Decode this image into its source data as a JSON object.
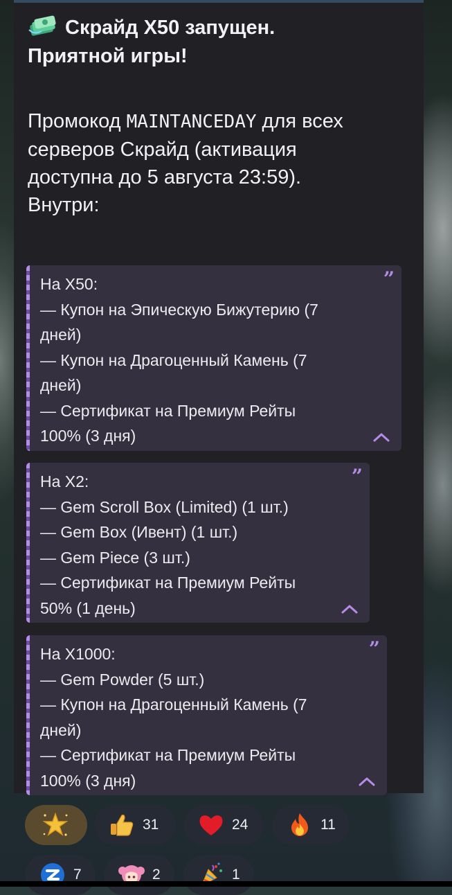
{
  "message": {
    "title_line1": "Скрайд X50 запущен.",
    "title_line2": "Приятной игры!",
    "body_pre": "Промокод ",
    "promo_code": "MAINTANCEDAY",
    "body_post_1": " для всех",
    "body_line2": "серверов Скрайд (активация",
    "body_line3": "доступна до 5 августа 23:59).",
    "body_line4": "Внутри:"
  },
  "quotes": [
    {
      "lines": [
        "На X50:",
        "— Купон на Эпическую Бижутерию (7",
        "дней)",
        "— Купон на Драгоценный Камень (7",
        "дней)",
        "— Сертификат на Премиум Рейты",
        "100% (3 дня)"
      ]
    },
    {
      "lines": [
        "На X2:",
        "— Gem Scroll Box (Limited) (1 шт.)",
        "— Gem Box (Ивент) (1 шт.)",
        "— Gem Piece (3 шт.)",
        "— Сертификат на Премиум Рейты",
        "50% (1 день)"
      ]
    },
    {
      "lines": [
        "На X1000:",
        "— Gem Powder (5 шт.)",
        "— Купон на Драгоценный Камень (7",
        "дней)",
        "— Сертификат на Премиум Рейты",
        "100% (3 дня)"
      ]
    }
  ],
  "reactions": [
    {
      "icon": "sparkle-star-icon",
      "count": ""
    },
    {
      "icon": "thumbs-up-icon",
      "count": "31"
    },
    {
      "icon": "heart-icon",
      "count": "24"
    },
    {
      "icon": "fire-icon",
      "count": "11"
    },
    {
      "icon": "app-logo-icon",
      "count": "7"
    },
    {
      "icon": "anime-girl-icon",
      "count": "2"
    },
    {
      "icon": "party-popper-icon",
      "count": "1"
    }
  ],
  "colors": {
    "bubble": "#212024",
    "quote_bg": "#35303f",
    "quote_accent": "#b58ce8",
    "text": "#f2f2f4"
  }
}
